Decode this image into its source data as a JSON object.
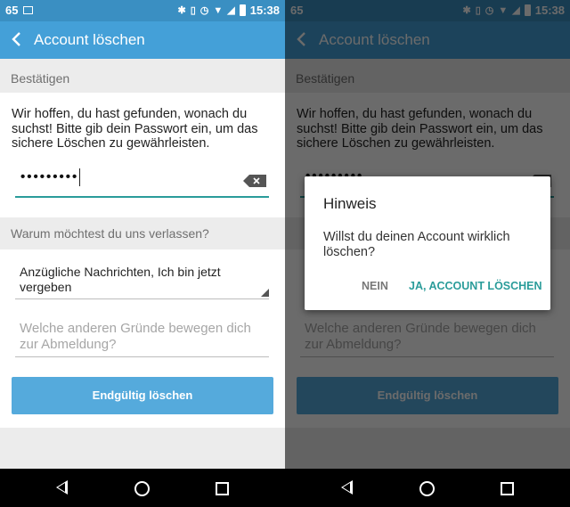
{
  "status_bar": {
    "notification_count": "65",
    "time": "15:38",
    "icons": [
      "image-icon",
      "bluetooth-icon",
      "vibrate-icon",
      "alarm-icon",
      "wifi-icon",
      "signal-icon",
      "battery-icon"
    ]
  },
  "app_bar": {
    "back_icon": "chevron-left-icon",
    "title": "Account löschen"
  },
  "confirm_section": {
    "header": "Bestätigen",
    "intro_text": "Wir hoffen, du hast gefunden, wonach du suchst! Bitte gib dein Passwort ein, um das sichere Löschen zu gewährleisten.",
    "password_value": "•••••••••",
    "clear_icon": "backspace-icon"
  },
  "reason_section": {
    "header": "Warum möchtest du uns verlassen?",
    "selected_reason": "Anzügliche Nachrichten, Ich bin jetzt vergeben",
    "other_reasons_placeholder": "Welche anderen Gründe bewegen dich zur Abmeldung?"
  },
  "final_button": "Endgültig löschen",
  "dialog": {
    "title": "Hinweis",
    "message": "Willst du deinen Account wirklich löschen?",
    "no_label": "NEIN",
    "yes_label": "JA, ACCOUNT LÖSCHEN"
  },
  "colors": {
    "status_bar": "#3a8fc2",
    "app_bar": "#44a0d8",
    "accent_teal": "#2a9c9a",
    "button": "#55aadc"
  }
}
